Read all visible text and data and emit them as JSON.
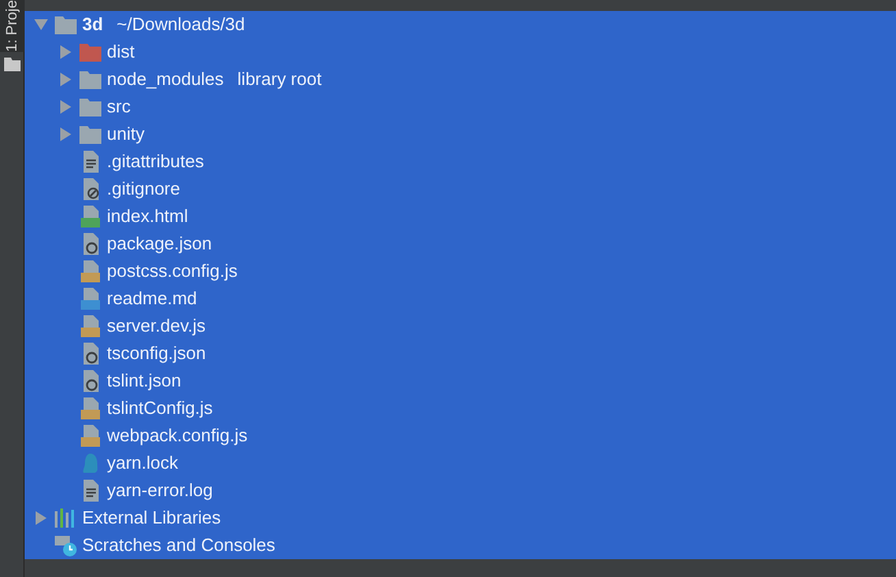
{
  "tool_strip": {
    "tab_label": "1: Proje"
  },
  "tree": [
    {
      "kind": "project-root",
      "label": "3d",
      "path": "~/Downloads/3d",
      "expanded": true,
      "selected": true,
      "children": [
        {
          "kind": "folder-excluded",
          "label": "dist",
          "expanded": false,
          "selected": true
        },
        {
          "kind": "folder",
          "label": "node_modules",
          "note": "library root",
          "expanded": false,
          "selected": true
        },
        {
          "kind": "folder",
          "label": "src",
          "expanded": false,
          "selected": true
        },
        {
          "kind": "folder",
          "label": "unity",
          "expanded": false,
          "selected": true
        },
        {
          "kind": "text",
          "label": ".gitattributes",
          "selected": true
        },
        {
          "kind": "ignore",
          "label": ".gitignore",
          "selected": true
        },
        {
          "kind": "html",
          "label": "index.html",
          "selected": true
        },
        {
          "kind": "config",
          "label": "package.json",
          "selected": true
        },
        {
          "kind": "js",
          "label": "postcss.config.js",
          "selected": true
        },
        {
          "kind": "md",
          "label": "readme.md",
          "selected": true
        },
        {
          "kind": "js",
          "label": "server.dev.js",
          "selected": true
        },
        {
          "kind": "config",
          "label": "tsconfig.json",
          "selected": true
        },
        {
          "kind": "config",
          "label": "tslint.json",
          "selected": true
        },
        {
          "kind": "js",
          "label": "tslintConfig.js",
          "selected": true
        },
        {
          "kind": "js",
          "label": "webpack.config.js",
          "selected": true
        },
        {
          "kind": "yarn",
          "label": "yarn.lock",
          "selected": true
        },
        {
          "kind": "text",
          "label": "yarn-error.log",
          "selected": true
        }
      ]
    },
    {
      "kind": "libraries",
      "label": "External Libraries",
      "expanded": false,
      "selected": true
    },
    {
      "kind": "scratches",
      "label": "Scratches and Consoles",
      "selected": true
    }
  ]
}
